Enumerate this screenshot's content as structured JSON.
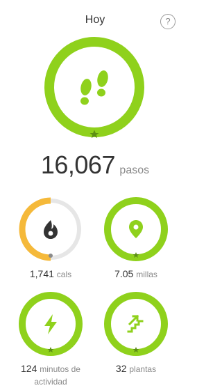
{
  "header": {
    "title": "Hoy",
    "help_label": "?"
  },
  "colors": {
    "accent_green": "#8fd11c",
    "icon_green": "#8fd11c",
    "calorie_orange": "#f5b93a",
    "track_gray": "#e6e6e6",
    "star_green": "#5d8f14"
  },
  "steps": {
    "value": "16,067",
    "unit": "pasos",
    "goal_progress": 1.0,
    "icon": "footprints-icon"
  },
  "calories": {
    "value": "1,741",
    "unit": "cals",
    "goal_progress": 0.47,
    "icon": "flame-icon"
  },
  "distance": {
    "value": "7.05",
    "unit": "millas",
    "goal_progress": 1.0,
    "icon": "location-pin-icon"
  },
  "active_minutes": {
    "value": "124",
    "unit": "minutos de actividad",
    "goal_progress": 1.0,
    "icon": "lightning-icon"
  },
  "floors": {
    "value": "32",
    "unit": "plantas",
    "goal_progress": 1.0,
    "icon": "stairs-icon"
  }
}
